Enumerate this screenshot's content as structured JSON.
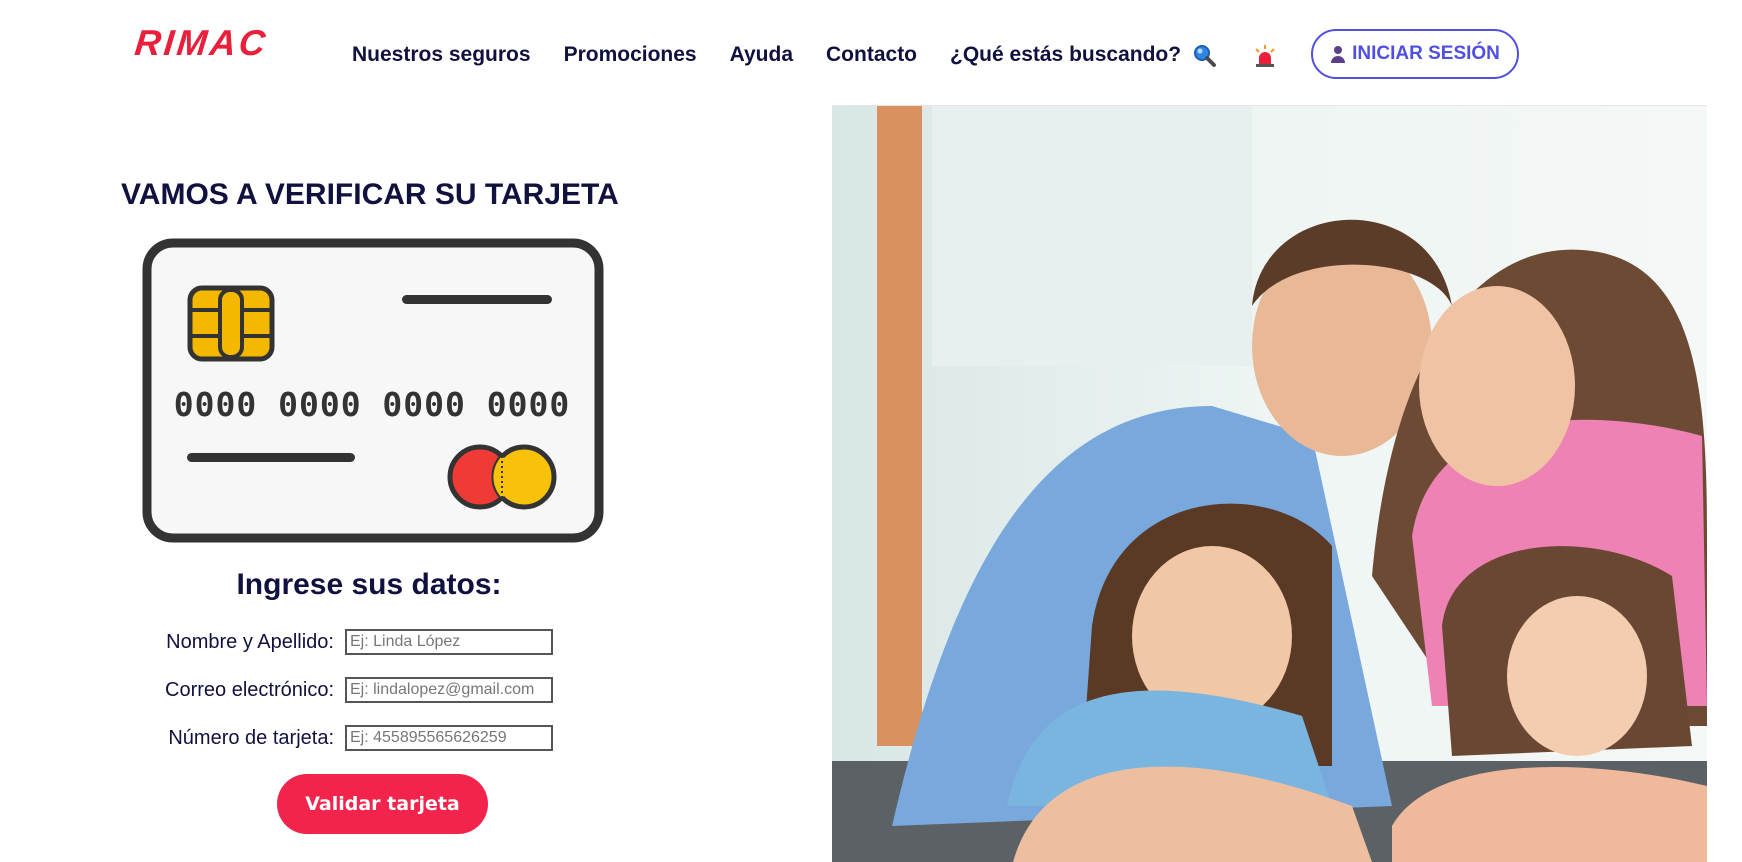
{
  "header": {
    "logo": "RIMAC",
    "nav": [
      "Nuestros seguros",
      "Promociones",
      "Ayuda",
      "Contacto",
      "¿Qué estás buscando?"
    ],
    "icons": [
      "search-icon",
      "siren-icon",
      "user-icon"
    ],
    "login_label": "INICIAR SESIÓN"
  },
  "main": {
    "title": "VAMOS A VERIFICAR SU TARJETA",
    "card": {
      "number": "0000 0000 0000 0000"
    },
    "form_title": "Ingrese sus datos:",
    "fields": [
      {
        "label": "Nombre y Apellido:",
        "placeholder": "Ej: Linda López"
      },
      {
        "label": "Correo electrónico:",
        "placeholder": "Ej: lindalopez@gmail.com"
      },
      {
        "label": "Número de tarjeta:",
        "placeholder": "Ej: 455895565626259"
      }
    ],
    "submit_label": "Validar tarjeta"
  },
  "colors": {
    "brand_red": "#e8203b",
    "navy": "#10113f",
    "accent_blue": "#4f4fe0",
    "button_red": "#f2244b"
  }
}
